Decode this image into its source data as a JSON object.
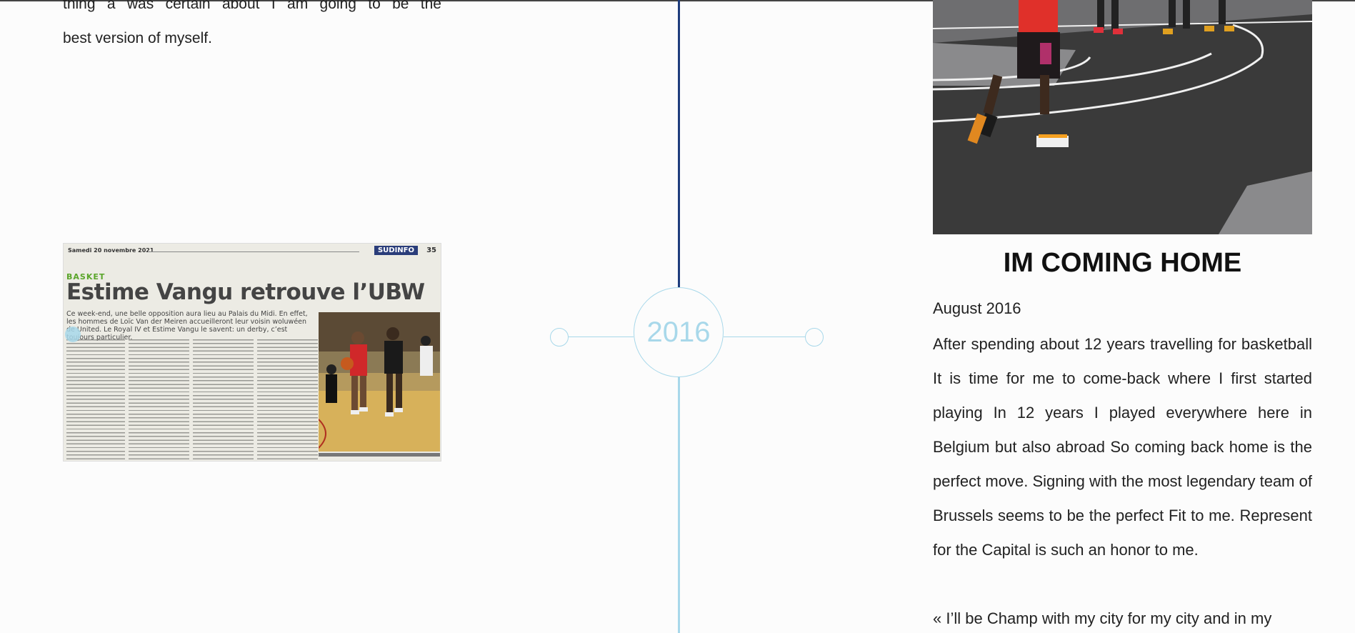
{
  "left": {
    "text_line_1": "thing a was certain about I am going to be the",
    "text_line_2": "best version of myself."
  },
  "newspaper": {
    "date": "Samedi 20 novembre 2021",
    "brand": "SUDINFO",
    "page": "35",
    "section": "BASKET",
    "headline": "Estime Vangu retrouve l’UBW",
    "lead": "Ce week-end, une belle opposition aura lieu au Palais du Midi. En effet, les hommes de Loïc Van der Meiren accueilleront leur voisin woluwéen de United. Le Royal IV et Estime Vangu le savent: un derby, c’est toujours particulier."
  },
  "timeline": {
    "year": "2016",
    "accent_dark": "#1e3c7c",
    "accent_light": "#a8d8ea"
  },
  "card": {
    "title": "IM COMING HOME",
    "date": "August 2016",
    "body": "After spending about 12 years travelling for basketball It is time for me to come-back where I first started playing In 12 years I played everywhere here in Belgium but also abroad So coming back home is the perfect move. Signing with the most legendary team of Brussels seems to be the perfect Fit to me. Represent for the Capital is such an honor to me.",
    "quote": "« I’ll be Champ with my city for my city and in my"
  }
}
